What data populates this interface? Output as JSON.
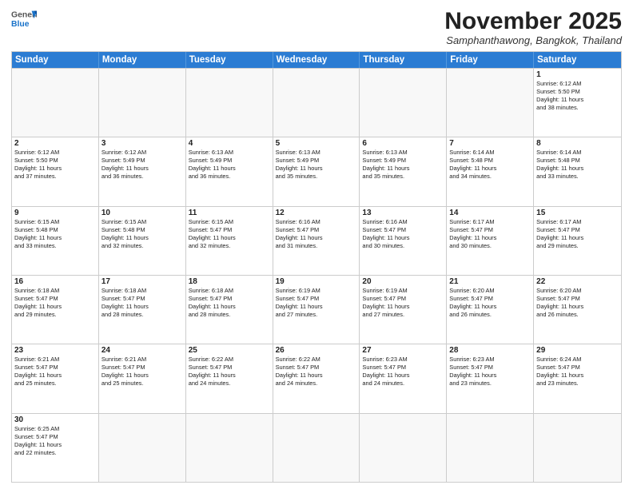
{
  "header": {
    "logo_general": "General",
    "logo_blue": "Blue",
    "month": "November 2025",
    "location": "Samphanthawong, Bangkok, Thailand"
  },
  "days_of_week": [
    "Sunday",
    "Monday",
    "Tuesday",
    "Wednesday",
    "Thursday",
    "Friday",
    "Saturday"
  ],
  "weeks": [
    [
      {
        "day": "",
        "text": ""
      },
      {
        "day": "",
        "text": ""
      },
      {
        "day": "",
        "text": ""
      },
      {
        "day": "",
        "text": ""
      },
      {
        "day": "",
        "text": ""
      },
      {
        "day": "",
        "text": ""
      },
      {
        "day": "1",
        "text": "Sunrise: 6:12 AM\nSunset: 5:50 PM\nDaylight: 11 hours\nand 38 minutes."
      }
    ],
    [
      {
        "day": "2",
        "text": "Sunrise: 6:12 AM\nSunset: 5:50 PM\nDaylight: 11 hours\nand 37 minutes."
      },
      {
        "day": "3",
        "text": "Sunrise: 6:12 AM\nSunset: 5:49 PM\nDaylight: 11 hours\nand 36 minutes."
      },
      {
        "day": "4",
        "text": "Sunrise: 6:13 AM\nSunset: 5:49 PM\nDaylight: 11 hours\nand 36 minutes."
      },
      {
        "day": "5",
        "text": "Sunrise: 6:13 AM\nSunset: 5:49 PM\nDaylight: 11 hours\nand 35 minutes."
      },
      {
        "day": "6",
        "text": "Sunrise: 6:13 AM\nSunset: 5:49 PM\nDaylight: 11 hours\nand 35 minutes."
      },
      {
        "day": "7",
        "text": "Sunrise: 6:14 AM\nSunset: 5:48 PM\nDaylight: 11 hours\nand 34 minutes."
      },
      {
        "day": "8",
        "text": "Sunrise: 6:14 AM\nSunset: 5:48 PM\nDaylight: 11 hours\nand 33 minutes."
      }
    ],
    [
      {
        "day": "9",
        "text": "Sunrise: 6:15 AM\nSunset: 5:48 PM\nDaylight: 11 hours\nand 33 minutes."
      },
      {
        "day": "10",
        "text": "Sunrise: 6:15 AM\nSunset: 5:48 PM\nDaylight: 11 hours\nand 32 minutes."
      },
      {
        "day": "11",
        "text": "Sunrise: 6:15 AM\nSunset: 5:47 PM\nDaylight: 11 hours\nand 32 minutes."
      },
      {
        "day": "12",
        "text": "Sunrise: 6:16 AM\nSunset: 5:47 PM\nDaylight: 11 hours\nand 31 minutes."
      },
      {
        "day": "13",
        "text": "Sunrise: 6:16 AM\nSunset: 5:47 PM\nDaylight: 11 hours\nand 30 minutes."
      },
      {
        "day": "14",
        "text": "Sunrise: 6:17 AM\nSunset: 5:47 PM\nDaylight: 11 hours\nand 30 minutes."
      },
      {
        "day": "15",
        "text": "Sunrise: 6:17 AM\nSunset: 5:47 PM\nDaylight: 11 hours\nand 29 minutes."
      }
    ],
    [
      {
        "day": "16",
        "text": "Sunrise: 6:18 AM\nSunset: 5:47 PM\nDaylight: 11 hours\nand 29 minutes."
      },
      {
        "day": "17",
        "text": "Sunrise: 6:18 AM\nSunset: 5:47 PM\nDaylight: 11 hours\nand 28 minutes."
      },
      {
        "day": "18",
        "text": "Sunrise: 6:18 AM\nSunset: 5:47 PM\nDaylight: 11 hours\nand 28 minutes."
      },
      {
        "day": "19",
        "text": "Sunrise: 6:19 AM\nSunset: 5:47 PM\nDaylight: 11 hours\nand 27 minutes."
      },
      {
        "day": "20",
        "text": "Sunrise: 6:19 AM\nSunset: 5:47 PM\nDaylight: 11 hours\nand 27 minutes."
      },
      {
        "day": "21",
        "text": "Sunrise: 6:20 AM\nSunset: 5:47 PM\nDaylight: 11 hours\nand 26 minutes."
      },
      {
        "day": "22",
        "text": "Sunrise: 6:20 AM\nSunset: 5:47 PM\nDaylight: 11 hours\nand 26 minutes."
      }
    ],
    [
      {
        "day": "23",
        "text": "Sunrise: 6:21 AM\nSunset: 5:47 PM\nDaylight: 11 hours\nand 25 minutes."
      },
      {
        "day": "24",
        "text": "Sunrise: 6:21 AM\nSunset: 5:47 PM\nDaylight: 11 hours\nand 25 minutes."
      },
      {
        "day": "25",
        "text": "Sunrise: 6:22 AM\nSunset: 5:47 PM\nDaylight: 11 hours\nand 24 minutes."
      },
      {
        "day": "26",
        "text": "Sunrise: 6:22 AM\nSunset: 5:47 PM\nDaylight: 11 hours\nand 24 minutes."
      },
      {
        "day": "27",
        "text": "Sunrise: 6:23 AM\nSunset: 5:47 PM\nDaylight: 11 hours\nand 24 minutes."
      },
      {
        "day": "28",
        "text": "Sunrise: 6:23 AM\nSunset: 5:47 PM\nDaylight: 11 hours\nand 23 minutes."
      },
      {
        "day": "29",
        "text": "Sunrise: 6:24 AM\nSunset: 5:47 PM\nDaylight: 11 hours\nand 23 minutes."
      }
    ],
    [
      {
        "day": "30",
        "text": "Sunrise: 6:25 AM\nSunset: 5:47 PM\nDaylight: 11 hours\nand 22 minutes."
      },
      {
        "day": "",
        "text": ""
      },
      {
        "day": "",
        "text": ""
      },
      {
        "day": "",
        "text": ""
      },
      {
        "day": "",
        "text": ""
      },
      {
        "day": "",
        "text": ""
      },
      {
        "day": "",
        "text": ""
      }
    ]
  ]
}
